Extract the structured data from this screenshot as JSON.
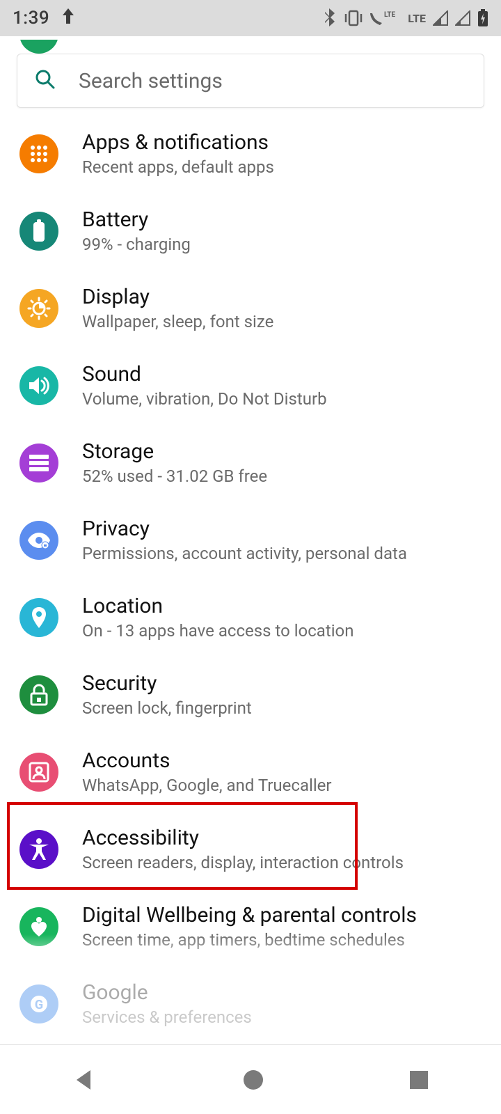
{
  "status": {
    "time": "1:39",
    "lte_label": "LTE"
  },
  "search": {
    "placeholder": "Search settings"
  },
  "rows": [
    {
      "key": "apps",
      "title": "Apps & notifications",
      "sub": "Recent apps, default apps",
      "color": "#f57c00"
    },
    {
      "key": "battery",
      "title": "Battery",
      "sub": "99% - charging",
      "color": "#168777"
    },
    {
      "key": "display",
      "title": "Display",
      "sub": "Wallpaper, sleep, font size",
      "color": "#f5a623"
    },
    {
      "key": "sound",
      "title": "Sound",
      "sub": "Volume, vibration, Do Not Disturb",
      "color": "#18b7a6"
    },
    {
      "key": "storage",
      "title": "Storage",
      "sub": "52% used - 31.02 GB free",
      "color": "#a43ed6"
    },
    {
      "key": "privacy",
      "title": "Privacy",
      "sub": "Permissions, account activity, personal data",
      "color": "#5b8def"
    },
    {
      "key": "location",
      "title": "Location",
      "sub": "On - 13 apps have access to location",
      "color": "#29b6d6"
    },
    {
      "key": "security",
      "title": "Security",
      "sub": "Screen lock, fingerprint",
      "color": "#1e8e3e"
    },
    {
      "key": "accounts",
      "title": "Accounts",
      "sub": "WhatsApp, Google, and Truecaller",
      "color": "#e84e73"
    },
    {
      "key": "a11y",
      "title": "Accessibility",
      "sub": "Screen readers, display, interaction controls",
      "color": "#5a0fc8"
    },
    {
      "key": "wellbeing",
      "title": "Digital Wellbeing & parental controls",
      "sub": "Screen time, app timers, bedtime schedules",
      "color": "#18b55d"
    },
    {
      "key": "google",
      "title": "Google",
      "sub": "Services & preferences",
      "color": "#1a73e8"
    }
  ]
}
